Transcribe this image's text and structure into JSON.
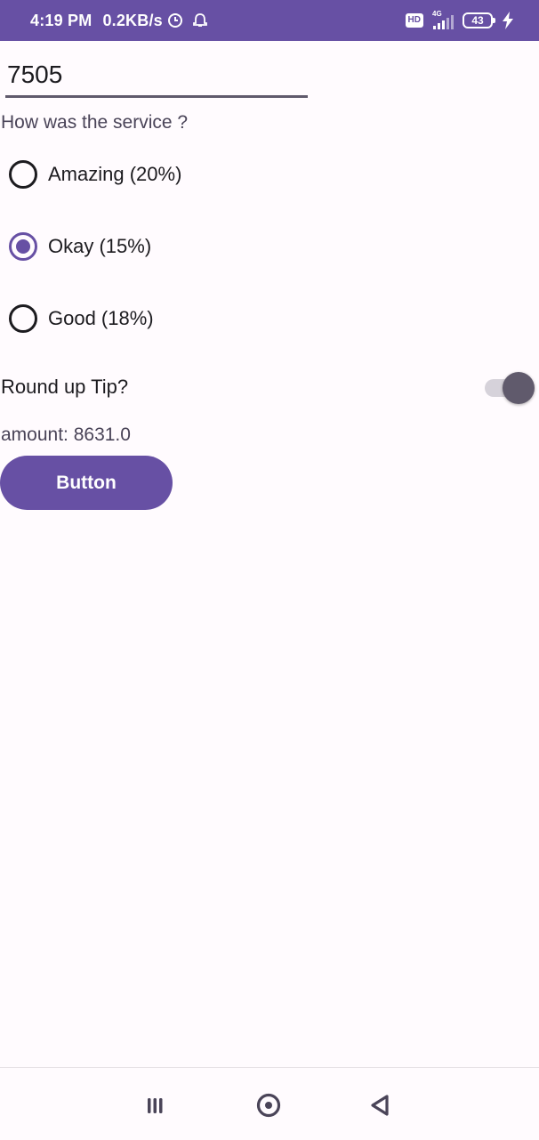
{
  "status_bar": {
    "time": "4:19 PM",
    "network_speed": "0.2KB/s",
    "hd_label": "HD",
    "network_type": "4G",
    "battery_level": "43"
  },
  "form": {
    "amount_value": "7505",
    "question": "How was the service ?",
    "options": [
      {
        "label": "Amazing (20%)",
        "checked": false
      },
      {
        "label": "Okay (15%)",
        "checked": true
      },
      {
        "label": "Good (18%)",
        "checked": false
      }
    ],
    "round_up_label": "Round up Tip?",
    "round_up_enabled": true,
    "amount_text": "amount: 8631.0",
    "button_label": "Button"
  },
  "nav_bar": {
    "recents_icon": "recents-icon",
    "home_icon": "home-icon",
    "back_icon": "back-icon"
  },
  "colors": {
    "primary": "#6750a4",
    "background": "#fffbfe",
    "switch_thumb": "#605a6c"
  }
}
